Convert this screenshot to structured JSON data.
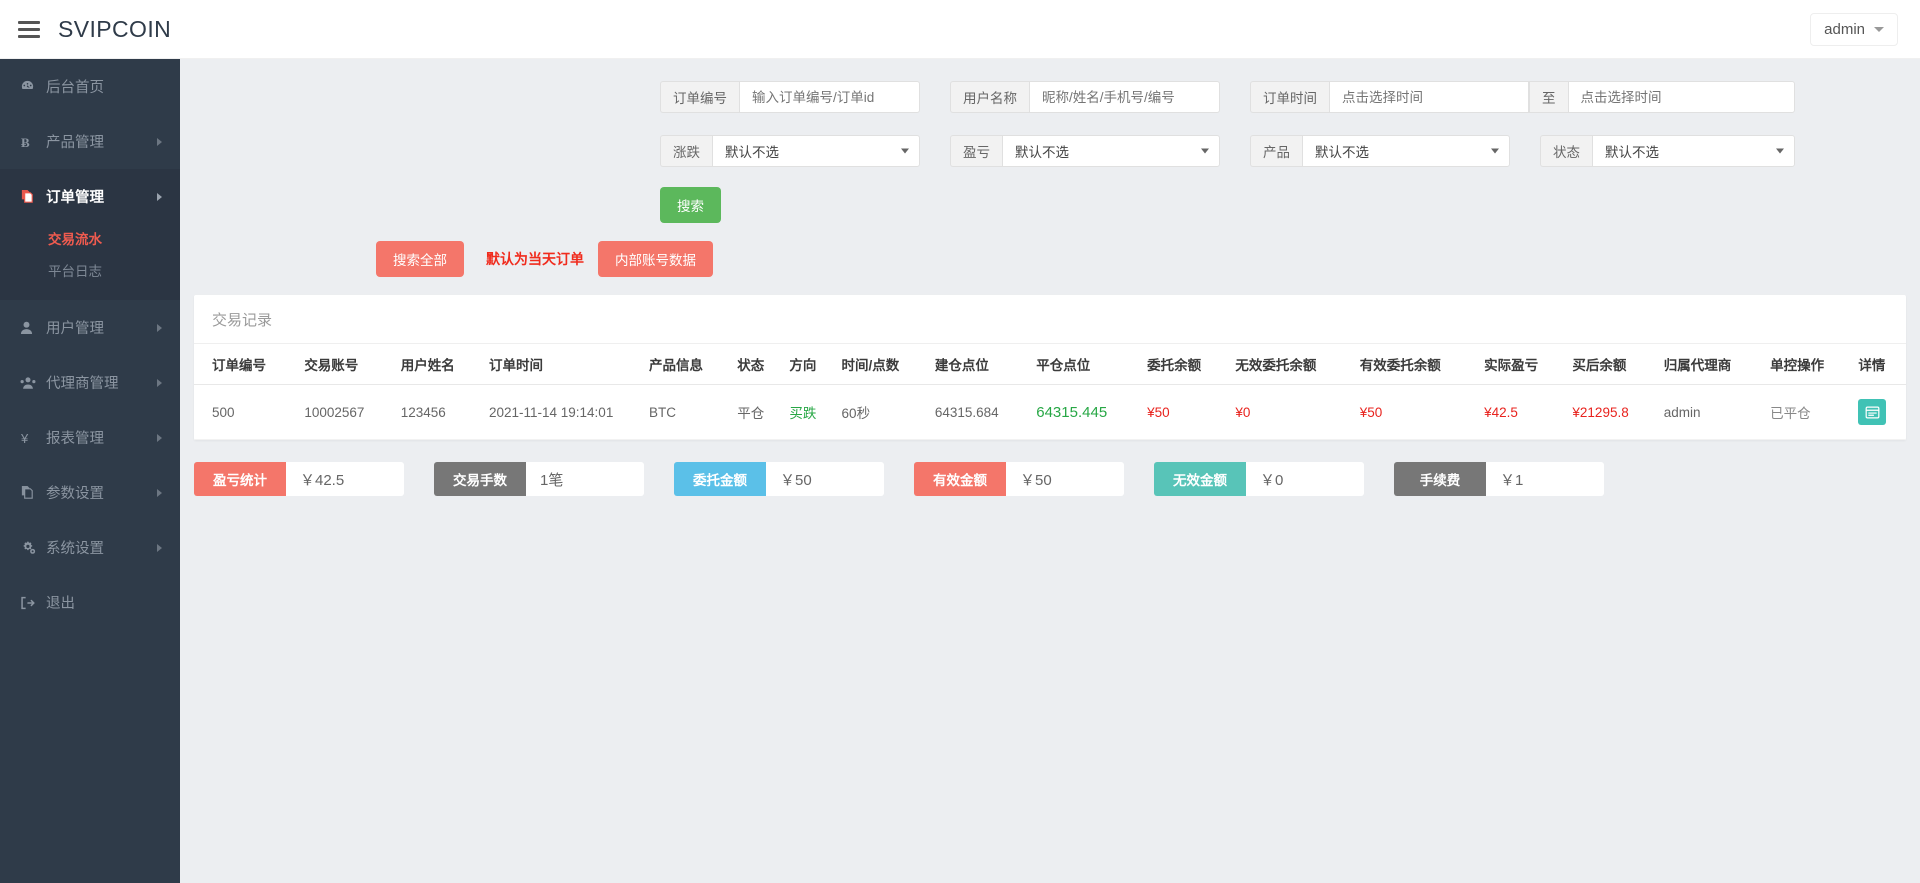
{
  "header": {
    "brand": "SVIPCOIN",
    "menu_icon": "hamburger-icon",
    "user": "admin"
  },
  "sidebar": {
    "items": [
      {
        "label": "后台首页",
        "icon": "dashboard-icon",
        "arrow": false,
        "active": false
      },
      {
        "label": "产品管理",
        "icon": "bitcoin-icon",
        "arrow": true,
        "active": false
      },
      {
        "label": "订单管理",
        "icon": "file-copy-icon",
        "arrow": true,
        "active": true,
        "children": [
          {
            "label": "交易流水",
            "active": true
          },
          {
            "label": "平台日志",
            "active": false
          }
        ]
      },
      {
        "label": "用户管理",
        "icon": "user-icon",
        "arrow": true,
        "active": false
      },
      {
        "label": "代理商管理",
        "icon": "users-icon",
        "arrow": true,
        "active": false
      },
      {
        "label": "报表管理",
        "icon": "yen-icon",
        "arrow": true,
        "active": false
      },
      {
        "label": "参数设置",
        "icon": "file-copy-icon",
        "arrow": true,
        "active": false
      },
      {
        "label": "系统设置",
        "icon": "gears-icon",
        "arrow": true,
        "active": false
      },
      {
        "label": "退出",
        "icon": "logout-icon",
        "arrow": false,
        "active": false
      }
    ]
  },
  "filters": {
    "order_no": {
      "label": "订单编号",
      "placeholder": "输入订单编号/订单id",
      "value": ""
    },
    "user_name": {
      "label": "用户名称",
      "placeholder": "昵称/姓名/手机号/编号",
      "value": ""
    },
    "order_time": {
      "label": "订单时间",
      "placeholder_from": "点击选择时间",
      "separator": "至",
      "placeholder_to": "点击选择时间",
      "value_from": "",
      "value_to": ""
    },
    "rise_fall": {
      "label": "涨跌",
      "value": "默认不选"
    },
    "profit_loss": {
      "label": "盈亏",
      "value": "默认不选"
    },
    "product": {
      "label": "产品",
      "value": "默认不选"
    },
    "status": {
      "label": "状态",
      "value": "默认不选"
    },
    "search_button": "搜索",
    "search_all_button": "搜索全部",
    "today_note": "默认为当天订单",
    "internal_account_button": "内部账号数据"
  },
  "table": {
    "title": "交易记录",
    "columns": [
      "订单编号",
      "交易账号",
      "用户姓名",
      "订单时间",
      "产品信息",
      "状态",
      "方向",
      "时间/点数",
      "建仓点位",
      "平仓点位",
      "委托余额",
      "无效委托余额",
      "有效委托余额",
      "实际盈亏",
      "买后余额",
      "归属代理商",
      "单控操作",
      "详情"
    ],
    "rows": [
      {
        "order_no": "500",
        "trade_account": "10002567",
        "user_name": "123456",
        "order_time": "2021-11-14 19:14:01",
        "product": "BTC",
        "status": "平仓",
        "direction": "买跌",
        "time_points": "60秒",
        "open_price": "64315.684",
        "close_price": "64315.445",
        "entrust_balance": "¥50",
        "invalid_entrust_balance": "¥0",
        "valid_entrust_balance": "¥50",
        "actual_profit": "¥42.5",
        "balance_after": "¥21295.8",
        "agent": "admin",
        "single_control": "已平仓",
        "detail_icon": "detail-window-icon"
      }
    ]
  },
  "stats": [
    {
      "label": "盈亏统计",
      "value": "￥42.5",
      "color": "#f4766a"
    },
    {
      "label": "交易手数",
      "value": "1笔",
      "color": "#777777"
    },
    {
      "label": "委托金额",
      "value": "￥50",
      "color": "#5bc0e8"
    },
    {
      "label": "有效金额",
      "value": "￥50",
      "color": "#f4766a"
    },
    {
      "label": "无效金额",
      "value": "￥0",
      "color": "#58c4b8"
    },
    {
      "label": "手续费",
      "value": "￥1",
      "color": "#777777"
    }
  ],
  "colors": {
    "sidebar_bg": "#2f3b49",
    "accent_red": "#f05b4f",
    "accent_green": "#5cb85c",
    "accent_teal": "#40c2b5"
  }
}
